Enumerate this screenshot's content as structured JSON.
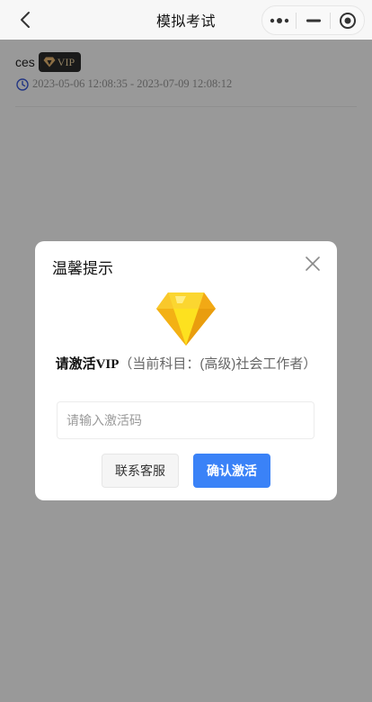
{
  "nav": {
    "title": "模拟考试",
    "back_icon": "chevron-left-icon",
    "more_icon": "more-dots-icon",
    "minimize_icon": "minimize-icon",
    "close_icon": "target-circle-icon"
  },
  "user": {
    "name": "ces",
    "vip_label": "VIP",
    "period": "2023-05-06 12:08:35 - 2023-07-09 12:08:12"
  },
  "modal": {
    "title": "温馨提示",
    "prompt_strong": "请激活VIP",
    "prompt_detail": "（当前科目：(高级)社会工作者）",
    "input_placeholder": "请输入激活码",
    "contact_label": "联系客服",
    "confirm_label": "确认激活"
  },
  "colors": {
    "primary": "#3a82f7",
    "diamond": "#f7c21a",
    "vip_badge_bg": "#2c2c2c",
    "vip_text": "#f3d7a4"
  }
}
